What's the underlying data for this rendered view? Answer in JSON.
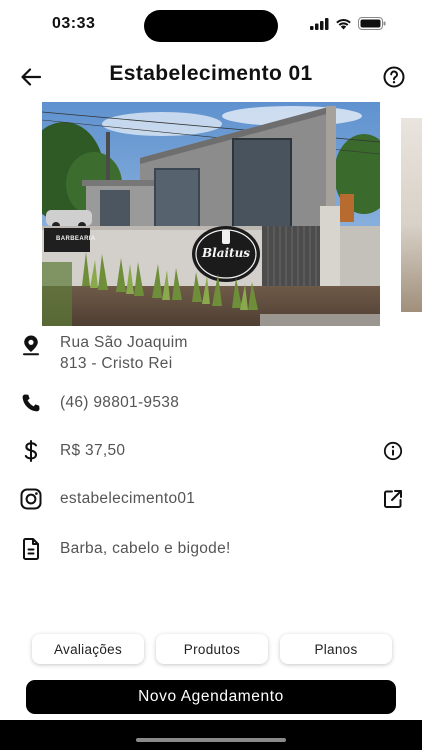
{
  "status_bar": {
    "time": "03:33"
  },
  "header": {
    "title": "Estabelecimento 01"
  },
  "gallery": {
    "signage_left": "BARBEARIA",
    "logo_text": "Blaitus"
  },
  "info": {
    "address_line1": "Rua São Joaquim",
    "address_line2": "813 - Cristo Rei",
    "phone": "(46) 98801-9538",
    "price": "R$ 37,50",
    "instagram": "estabelecimento01",
    "description": "Barba, cabelo e bigode!"
  },
  "tabs": [
    {
      "label": "Avaliações"
    },
    {
      "label": "Produtos"
    },
    {
      "label": "Planos"
    }
  ],
  "cta": {
    "label": "Novo Agendamento"
  },
  "icons": {
    "back": "arrow-left-icon",
    "help": "question-circle-icon",
    "location": "map-pin-icon",
    "phone": "phone-icon",
    "price": "dollar-icon",
    "info": "info-circle-icon",
    "instagram": "instagram-icon",
    "external": "external-link-icon",
    "description": "document-icon"
  }
}
